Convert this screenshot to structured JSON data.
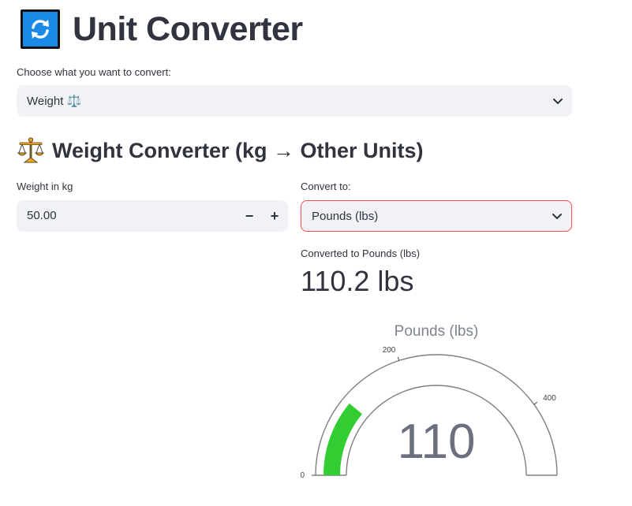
{
  "header": {
    "title": "Unit Converter",
    "icon": "refresh-arrows-icon"
  },
  "category_select": {
    "label": "Choose what you want to convert:",
    "value": "Weight ⚖️"
  },
  "section": {
    "title": "Weight Converter (kg → Other Units)",
    "icon": "scales-icon"
  },
  "weight_input": {
    "label": "Weight in kg",
    "value": "50.00",
    "decrement": "−",
    "increment": "+"
  },
  "target_select": {
    "label": "Convert to:",
    "value": "Pounds (lbs)"
  },
  "result": {
    "label": "Converted to Pounds (lbs)",
    "value": "110.2 lbs"
  },
  "gauge": {
    "title": "Pounds (lbs)",
    "value": 110,
    "value_text": "110",
    "range": [
      0,
      500
    ],
    "ticks": [
      "0",
      "200",
      "400"
    ],
    "bar_color": "#32cd32"
  },
  "colors": {
    "accent": "#ff4b4b",
    "input_bg": "#f0f2f6",
    "text": "#31333f"
  }
}
